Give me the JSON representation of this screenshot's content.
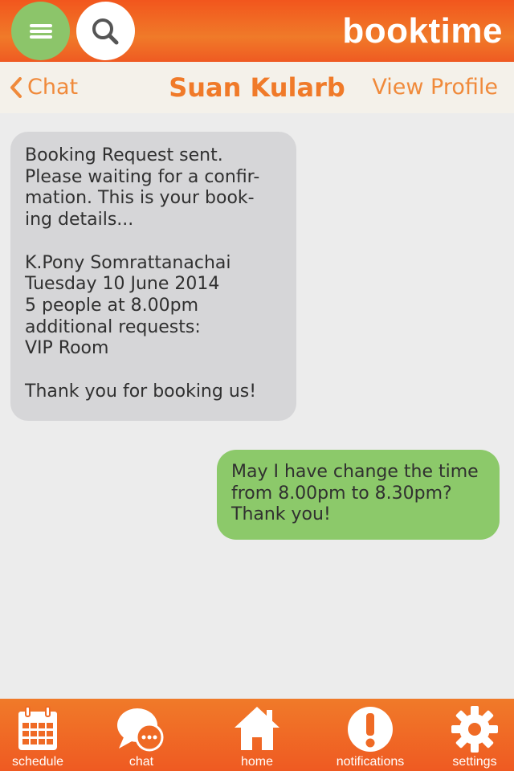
{
  "header": {
    "brand": "booktime",
    "menu_icon": "hamburger-menu-icon",
    "search_icon": "search-icon",
    "accent": "#f07a29",
    "menu_color": "#8cc56a"
  },
  "subheader": {
    "back_label": "Chat",
    "contact_name": "Suan Kularb",
    "view_profile_label": "View Profile"
  },
  "messages": [
    {
      "direction": "incoming",
      "text": "Booking Request sent.\nPlease waiting for a confir-\nmation. This is your book-\ning details...\n\nK.Pony Somrattanachai\nTuesday 10 June 2014\n5 people at 8.00pm\nadditional requests:\nVIP Room\n\nThank you for booking us!",
      "color": "#d6d6d8"
    },
    {
      "direction": "outgoing",
      "text": "May I have change the time\nfrom 8.00pm to 8.30pm?\nThank you!",
      "color": "#8cc96a"
    }
  ],
  "tabs": [
    {
      "label": "schedule",
      "icon": "calendar-icon"
    },
    {
      "label": "chat",
      "icon": "chat-bubble-icon"
    },
    {
      "label": "home",
      "icon": "home-icon"
    },
    {
      "label": "notifications",
      "icon": "exclamation-icon"
    },
    {
      "label": "settings",
      "icon": "gear-icon"
    }
  ]
}
